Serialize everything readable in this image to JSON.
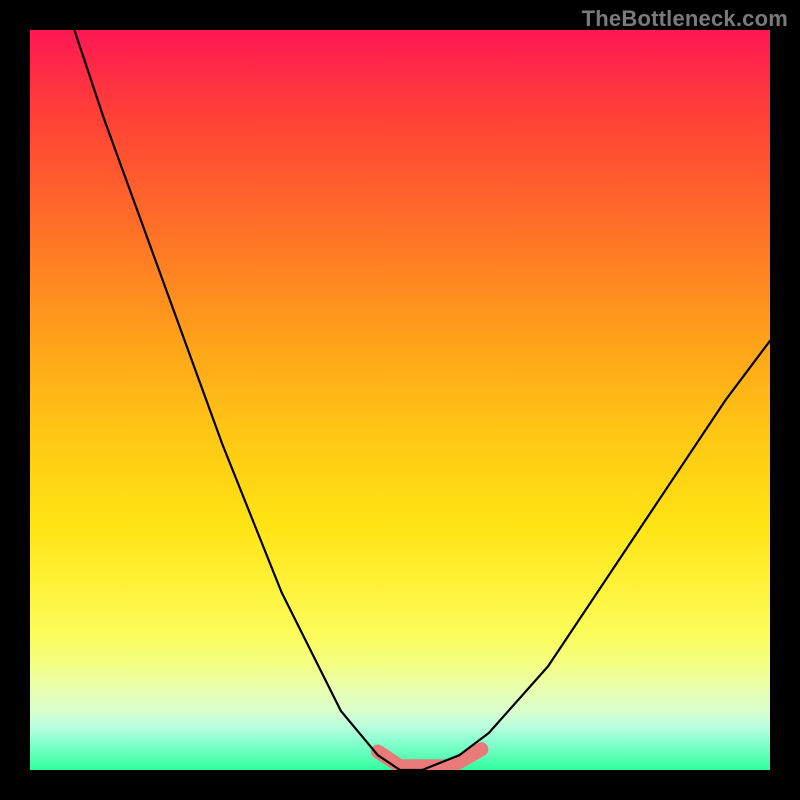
{
  "watermark": "TheBottleneck.com",
  "chart_data": {
    "type": "line",
    "title": "",
    "xlabel": "",
    "ylabel": "",
    "xlim": [
      0,
      1
    ],
    "ylim": [
      0,
      1
    ],
    "series": [
      {
        "name": "bottleneck-curve",
        "color": "#000000",
        "width": 2.2,
        "x": [
          0.06,
          0.1,
          0.18,
          0.26,
          0.34,
          0.42,
          0.47,
          0.5,
          0.53,
          0.58,
          0.62,
          0.7,
          0.78,
          0.86,
          0.94,
          1.0
        ],
        "y": [
          1.0,
          0.88,
          0.66,
          0.44,
          0.24,
          0.08,
          0.02,
          0.0,
          0.0,
          0.02,
          0.05,
          0.14,
          0.26,
          0.38,
          0.5,
          0.58
        ]
      },
      {
        "name": "tolerance-band",
        "color": "#e97a7a",
        "width": 14,
        "x": [
          0.47,
          0.5,
          0.53,
          0.57,
          0.61
        ],
        "y": [
          0.025,
          0.005,
          0.005,
          0.005,
          0.028
        ]
      }
    ],
    "gradient_stops": [
      {
        "pos": 0.0,
        "color": "#ff1853"
      },
      {
        "pos": 0.12,
        "color": "#ff4236"
      },
      {
        "pos": 0.28,
        "color": "#ff7426"
      },
      {
        "pos": 0.42,
        "color": "#ffa21a"
      },
      {
        "pos": 0.55,
        "color": "#ffc814"
      },
      {
        "pos": 0.67,
        "color": "#ffe414"
      },
      {
        "pos": 0.76,
        "color": "#fff33e"
      },
      {
        "pos": 0.82,
        "color": "#fbfe5e"
      },
      {
        "pos": 0.86,
        "color": "#f3ff86"
      },
      {
        "pos": 0.89,
        "color": "#e9ffae"
      },
      {
        "pos": 0.92,
        "color": "#d9ffcc"
      },
      {
        "pos": 0.94,
        "color": "#bcffe0"
      },
      {
        "pos": 0.96,
        "color": "#8cffd2"
      },
      {
        "pos": 0.98,
        "color": "#5effb8"
      },
      {
        "pos": 1.0,
        "color": "#30ff9a"
      }
    ]
  }
}
